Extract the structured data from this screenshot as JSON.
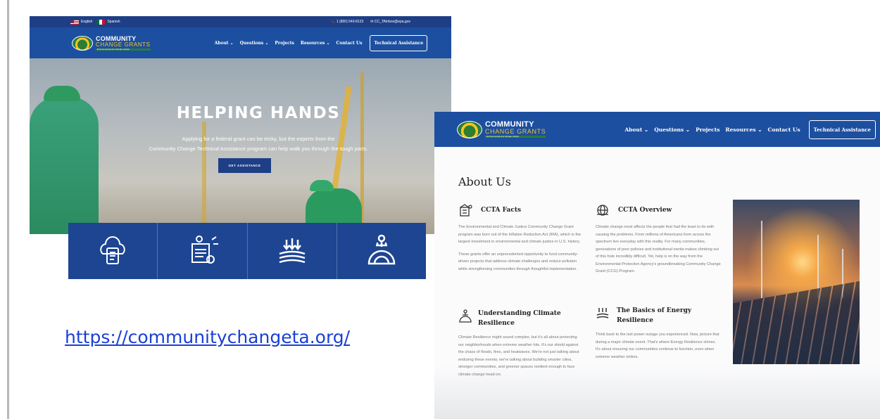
{
  "left_site": {
    "topbar": {
      "lang_english": "English",
      "lang_spanish": "Spanish",
      "phone": "1 (800) 540-8123",
      "email": "CC_TAInbox@epa.gov"
    },
    "logo": {
      "line1": "COMMUNITY",
      "line2": "CHANGE GRANTS",
      "line3": "Environmental and Climate Justice"
    },
    "nav": [
      "About ⌄",
      "Questions ⌄",
      "Projects",
      "Resources ⌄",
      "Contact Us"
    ],
    "cta": "Technical Assistance",
    "hero": {
      "title": "HELPING HANDS",
      "subtitle_line1": "Applying for a federal grant can be tricky, but the experts from the",
      "subtitle_line2": "Community Change Technical Assistance program can help walk you through the tough parts.",
      "button": "GET ASSISTANCE"
    },
    "icons": [
      "community-cloud-icon",
      "grant-document-icon",
      "energy-resilience-icon",
      "climate-resilience-icon"
    ]
  },
  "url": "https://communitychangeta.org/",
  "right_site": {
    "logo": {
      "line1": "COMMUNITY",
      "line2": "CHANGE GRANTS",
      "line3": "Environmental and Climate Justice"
    },
    "nav": [
      "About ⌄",
      "Questions ⌄",
      "Projects",
      "Resources ⌄",
      "Contact Us"
    ],
    "cta": "Technical Assistance",
    "about_title": "About Us",
    "facts": {
      "title": "CCTA Facts",
      "p1": "The Environmental and Climate Justice Community Change Grant program was born out of the Inflation Reduction Act (IRA), which is the largest investment in environmental and climate justice in U.S. history.",
      "p2": "These grants offer an unprecedented opportunity to fund community-driven projects that address climate challenges and reduce pollution while strengthening communities through thoughtful implementation."
    },
    "overview": {
      "title": "CCTA Overview",
      "p1": "Climate change most affects the people that had the least to do with causing the problems. From millions of Americans from across the spectrum live everyday with this reality. For many communities, generations of poor policies and institutional inertia makes climbing out of this hole incredibly difficult. Yet, help is on the way from the Environmental Protection Agency's groundbreaking Community Change Grant (CCG) Program."
    },
    "resilience": {
      "title": "Understanding Climate Resilience",
      "p1": "Climate Resilience might sound complex, but it's all about protecting our neighborhoods when extreme weather hits. It's our shield against the chaos of floods, fires, and heatwaves. We're not just talking about enduring these events; we're talking about building smarter cities, stronger communities, and greener spaces resilient enough to face climate change head-on."
    },
    "energy": {
      "title": "The Basics of Energy Resilience",
      "p1": "Think back to the last power outage you experienced. Now, picture that during a major climate event. That's where Energy Resilience shines. It's about ensuring our communities continue to function, even when extreme weather strikes."
    }
  }
}
